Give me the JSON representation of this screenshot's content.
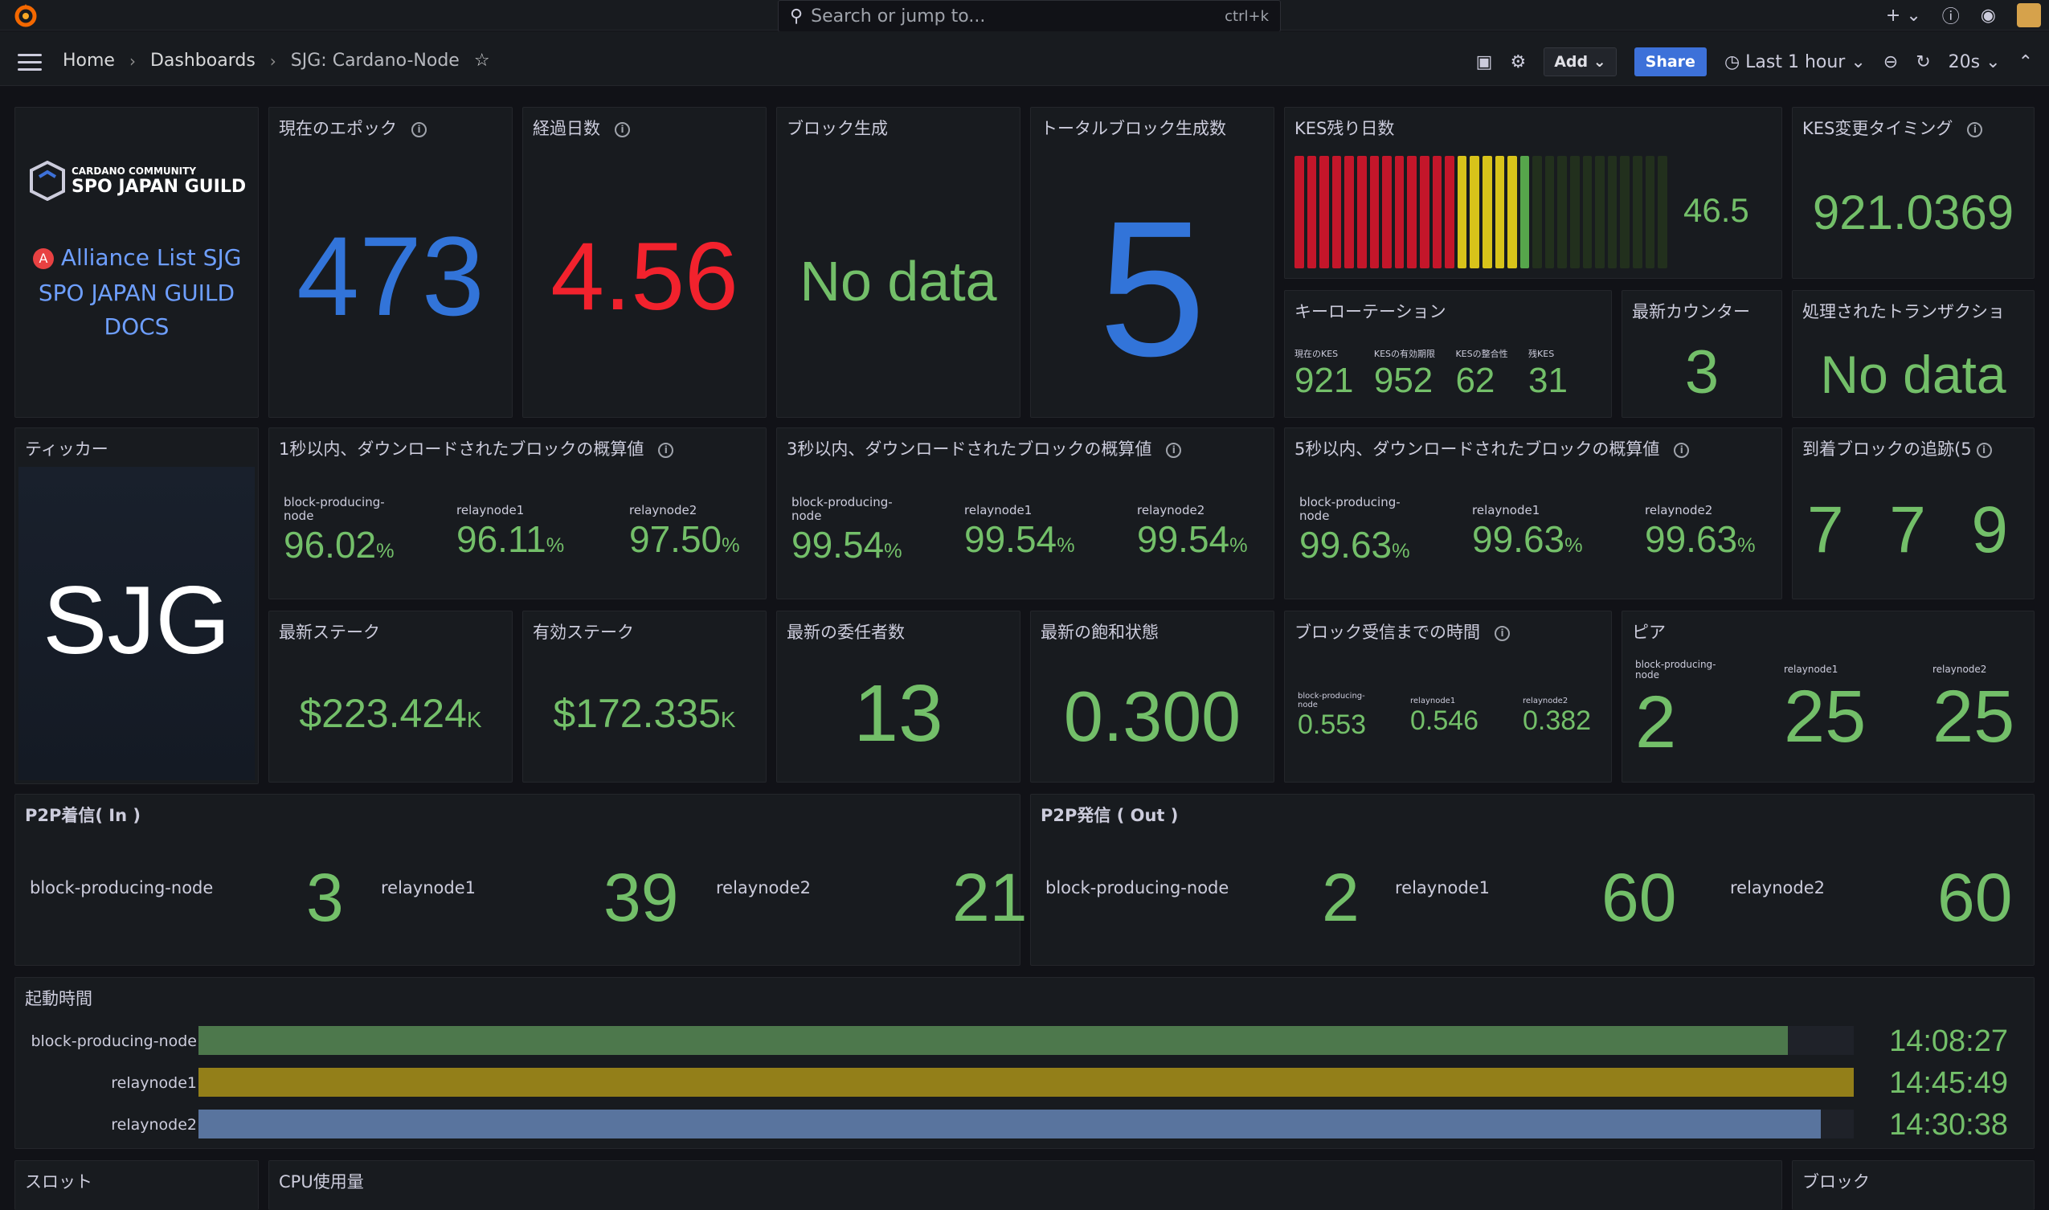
{
  "topbar": {
    "search_placeholder": "Search or jump to...",
    "search_shortcut": "ctrl+k"
  },
  "nav": {
    "home": "Home",
    "dashboards": "Dashboards",
    "current": "SJG: Cardano-Node",
    "add": "Add",
    "share": "Share",
    "time_range": "Last 1 hour",
    "refresh": "20s"
  },
  "logo_panel": {
    "brand_top": "CARDANO COMMUNITY",
    "brand_main": "SPO JAPAN GUILD",
    "link1": "Alliance List SJG",
    "link2": "SPO JAPAN GUILD",
    "link3": "DOCS"
  },
  "epoch": {
    "title": "現在のエポック",
    "value": "473"
  },
  "days": {
    "title": "経過日数",
    "value": "4.56"
  },
  "block_gen": {
    "title": "ブロック生成",
    "value": "No data"
  },
  "total_blocks": {
    "title": "トータルブロック生成数",
    "value": "5"
  },
  "kes_days": {
    "title": "KES残り日数",
    "value": "46.5",
    "level_fraction": 0.16
  },
  "kes_change": {
    "title": "KES変更タイミング",
    "value": "921.0369"
  },
  "key_rotation": {
    "title": "キーローテーション",
    "items": [
      {
        "label": "現在のKES",
        "value": "921"
      },
      {
        "label": "KESの有効期限",
        "value": "952"
      },
      {
        "label": "KESの整合性",
        "value": "62"
      },
      {
        "label": "残KES",
        "value": "31"
      }
    ]
  },
  "counter": {
    "title": "最新カウンター",
    "value": "3"
  },
  "tx": {
    "title": "処理されたトランザクショ",
    "value": "No data"
  },
  "ticker": {
    "title": "ティッカー",
    "value": "SJG"
  },
  "dl1": {
    "title": "1秒以内、ダウンロードされたブロックの概算値",
    "items": [
      {
        "label": "block-producing-\nnode",
        "value": "96.02",
        "unit": "%"
      },
      {
        "label": "relaynode1",
        "value": "96.11",
        "unit": "%"
      },
      {
        "label": "relaynode2",
        "value": "97.50",
        "unit": "%"
      }
    ]
  },
  "dl3": {
    "title": "3秒以内、ダウンロードされたブロックの概算値",
    "items": [
      {
        "label": "block-producing-\nnode",
        "value": "99.54",
        "unit": "%"
      },
      {
        "label": "relaynode1",
        "value": "99.54",
        "unit": "%"
      },
      {
        "label": "relaynode2",
        "value": "99.54",
        "unit": "%"
      }
    ]
  },
  "dl5": {
    "title": "5秒以内、ダウンロードされたブロックの概算値",
    "items": [
      {
        "label": "block-producing-\nnode",
        "value": "99.63",
        "unit": "%"
      },
      {
        "label": "relaynode1",
        "value": "99.63",
        "unit": "%"
      },
      {
        "label": "relaynode2",
        "value": "99.63",
        "unit": "%"
      }
    ]
  },
  "arrival": {
    "title": "到着ブロックの追跡(5",
    "values": [
      "7",
      "7",
      "9"
    ]
  },
  "stake": {
    "title": "最新ステーク",
    "value": "$223.424",
    "suffix": "K"
  },
  "active_stake": {
    "title": "有効ステーク",
    "value": "$172.335",
    "suffix": "K"
  },
  "delegators": {
    "title": "最新の委任者数",
    "value": "13"
  },
  "saturation": {
    "title": "最新の飽和状態",
    "value": "0.300"
  },
  "recv_time": {
    "title": "ブロック受信までの時間",
    "items": [
      {
        "label": "block-producing-\nnode",
        "value": "0.553"
      },
      {
        "label": "relaynode1",
        "value": "0.546"
      },
      {
        "label": "relaynode2",
        "value": "0.382"
      }
    ]
  },
  "peers": {
    "title": "ピア",
    "items": [
      {
        "label": "block-producing-\nnode",
        "value": "2"
      },
      {
        "label": "relaynode1",
        "value": "25"
      },
      {
        "label": "relaynode2",
        "value": "25"
      }
    ]
  },
  "p2p_in": {
    "title": "P2P着信( In )",
    "items": [
      {
        "label": "block-producing-node",
        "value": "3"
      },
      {
        "label": "relaynode1",
        "value": "39"
      },
      {
        "label": "relaynode2",
        "value": "21"
      }
    ]
  },
  "p2p_out": {
    "title": "P2P発信 ( Out )",
    "items": [
      {
        "label": "block-producing-node",
        "value": "2"
      },
      {
        "label": "relaynode1",
        "value": "60"
      },
      {
        "label": "relaynode2",
        "value": "60"
      }
    ]
  },
  "uptime": {
    "title": "起動時間",
    "rows": [
      {
        "label": "block-producing-node",
        "value": "14:08:27",
        "fill": 0.96,
        "color": "#73bf69"
      },
      {
        "label": "relaynode1",
        "value": "14:45:49",
        "fill": 1.0,
        "color": "#f2cc0c"
      },
      {
        "label": "relaynode2",
        "value": "14:30:38",
        "fill": 0.98,
        "color": "#8ab8ff"
      }
    ]
  },
  "bottom": {
    "slot": "スロット",
    "cpu": "CPU使用量",
    "block": "ブロック"
  }
}
